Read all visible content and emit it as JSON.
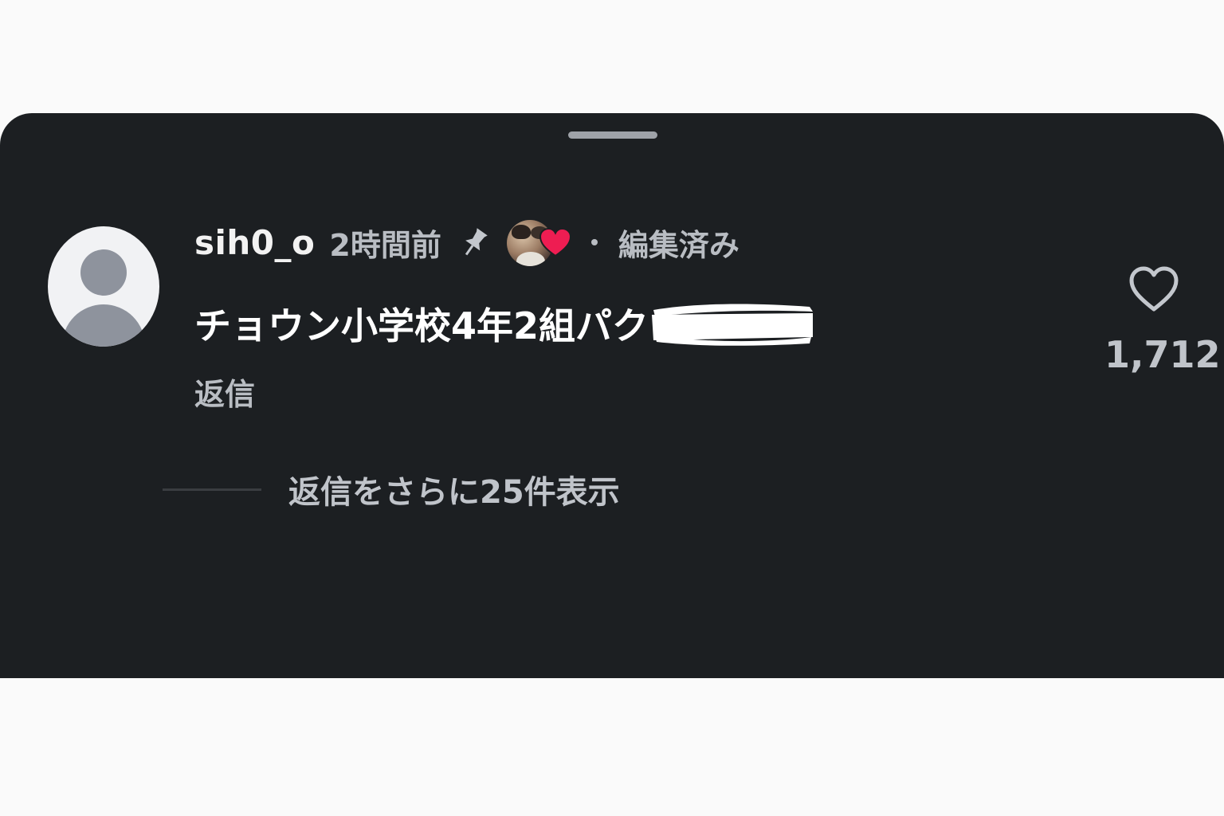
{
  "comment": {
    "username": "sih0_o",
    "timestamp": "2時間前",
    "edited_label": "編集済み",
    "text": "チョウン小学校4年2組パク",
    "reply_label": "返信",
    "more_replies_label": "返信をさらに25件表示",
    "like_count": "1,712",
    "pinned": true,
    "liked_by_creator": true
  },
  "colors": {
    "sheet_background": "#1c1f22",
    "page_background": "#fafafa",
    "heart_badge": "#ee1d52",
    "secondary_text": "#b9bdc3"
  },
  "icons": {
    "pin": "pin-icon",
    "like": "heart-icon",
    "creator_badge": "heart-badge-icon",
    "avatar": "default-avatar-icon"
  }
}
